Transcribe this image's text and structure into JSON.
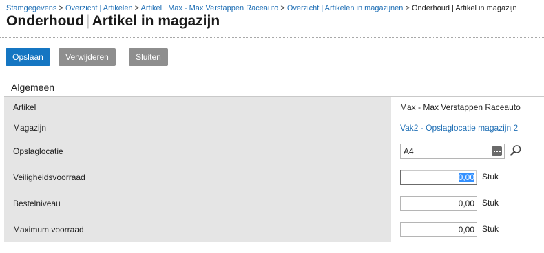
{
  "breadcrumb": {
    "items": [
      {
        "label": "Stamgegevens"
      },
      {
        "label": "Overzicht | Artikelen"
      },
      {
        "label": "Artikel | Max - Max Verstappen Raceauto"
      },
      {
        "label": "Overzicht | Artikelen in magazijnen"
      }
    ],
    "current": "Onderhoud | Artikel in magazijn",
    "separator": ">"
  },
  "page": {
    "title_main": "Onderhoud",
    "title_sub": "Artikel in magazijn"
  },
  "toolbar": {
    "save_label": "Opslaan",
    "delete_label": "Verwijderen",
    "close_label": "Sluiten"
  },
  "section": {
    "title": "Algemeen"
  },
  "form": {
    "artikel_label": "Artikel",
    "artikel_value": "Max - Max Verstappen Raceauto",
    "magazijn_label": "Magazijn",
    "magazijn_value": "Vak2 - Opslaglocatie magazijn 2",
    "opslaglocatie_label": "Opslaglocatie",
    "opslaglocatie_value": "A4",
    "veiligheidsvoorraad_label": "Veiligheidsvoorraad",
    "veiligheidsvoorraad_value": "0,00",
    "bestelniveau_label": "Bestelniveau",
    "bestelniveau_value": "0,00",
    "maximum_label": "Maximum voorraad",
    "maximum_value": "0,00",
    "unit": "Stuk"
  },
  "colors": {
    "primary": "#1576c2",
    "gray_button": "#8e8e8e",
    "link": "#1f6fb5",
    "form_background": "#e5e5e5"
  }
}
